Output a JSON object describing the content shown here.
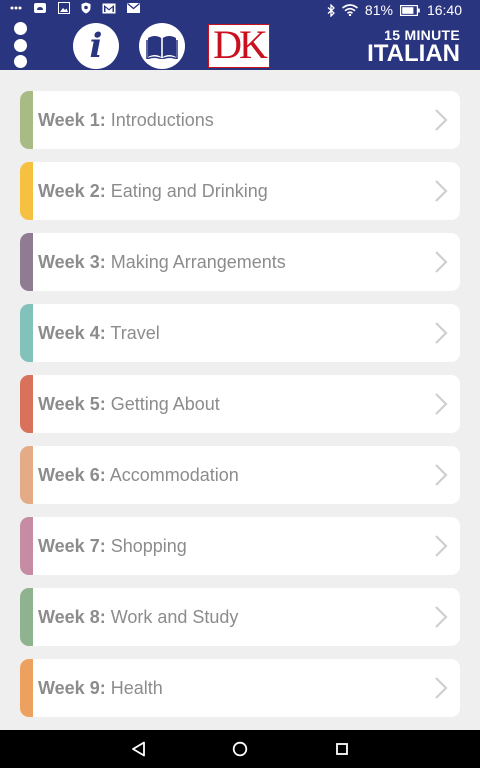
{
  "status_bar": {
    "left_icons": [
      "more-icon",
      "cloud-icon",
      "image-icon",
      "shield-icon",
      "gmail-icon",
      "mail-icon"
    ],
    "battery_percent": "81%",
    "time": "16:40"
  },
  "header": {
    "title_line1": "15 MINUTE",
    "title_line2": "ITALIAN",
    "logo_text": "DK",
    "info_glyph": "i"
  },
  "weeks": [
    {
      "prefix": "Week 1:",
      "title": " Introductions",
      "color": "#a9bb84"
    },
    {
      "prefix": "Week 2:",
      "title": " Eating and Drinking",
      "color": "#f6c040"
    },
    {
      "prefix": "Week 3:",
      "title": " Making Arrangements",
      "color": "#8f7b92"
    },
    {
      "prefix": "Week 4:",
      "title": " Travel",
      "color": "#83c1bb"
    },
    {
      "prefix": "Week 5:",
      "title": " Getting About",
      "color": "#da725b"
    },
    {
      "prefix": "Week 6:",
      "title": " Accommodation",
      "color": "#e3ab86"
    },
    {
      "prefix": "Week 7:",
      "title": " Shopping",
      "color": "#c68ca4"
    },
    {
      "prefix": "Week 8:",
      "title": " Work and Study",
      "color": "#8fb38f"
    },
    {
      "prefix": "Week 9:",
      "title": " Health",
      "color": "#eda15f"
    }
  ],
  "colors": {
    "header_bg": "#2a3580",
    "page_bg": "#efefef",
    "text": "#8c8c8c",
    "chevron": "#cfcfcf"
  }
}
